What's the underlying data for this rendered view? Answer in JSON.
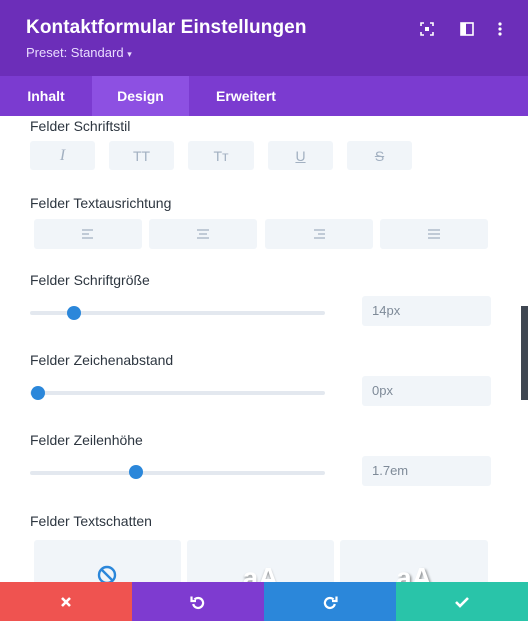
{
  "header": {
    "title": "Kontaktformular Einstellungen",
    "preset_label": "Preset: Standard",
    "bg": "#6c2eb9",
    "icons": [
      "expand-icon",
      "sidebar-toggle-icon",
      "more-options-icon"
    ]
  },
  "tabs": [
    {
      "label": "Inhalt",
      "active": false
    },
    {
      "label": "Design",
      "active": true
    },
    {
      "label": "Erweitert",
      "active": false
    }
  ],
  "sections": {
    "font_style": {
      "label": "Felder Schriftstil",
      "buttons": [
        "I",
        "TT",
        "Tт",
        "U",
        "S"
      ]
    },
    "text_align": {
      "label": "Felder Textausrichtung",
      "options": [
        "align-left",
        "align-center",
        "align-right",
        "align-justify"
      ]
    },
    "font_size": {
      "label": "Felder Schriftgröße",
      "value": "14px"
    },
    "letter_spacing": {
      "label": "Felder Zeichenabstand",
      "value": "0px"
    },
    "line_height": {
      "label": "Felder Zeilenhöhe",
      "value": "1.7em"
    },
    "text_shadow": {
      "label": "Felder Textschatten",
      "preview_text": "aA",
      "options": [
        "none",
        "preset-1",
        "preset-2"
      ]
    }
  },
  "footer": {
    "buttons": [
      {
        "name": "cancel",
        "icon": "close-icon",
        "color": "#ef5350"
      },
      {
        "name": "undo",
        "icon": "undo-icon",
        "color": "#7e3bd0"
      },
      {
        "name": "redo",
        "icon": "redo-icon",
        "color": "#2b87da"
      },
      {
        "name": "save",
        "icon": "check-icon",
        "color": "#29c4a9"
      }
    ]
  }
}
